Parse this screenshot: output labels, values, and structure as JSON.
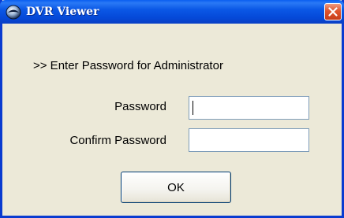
{
  "window": {
    "title": "DVR Viewer",
    "icon": "dvr-app-icon",
    "close_icon": "close-icon"
  },
  "dialog": {
    "prompt": ">> Enter Password for Administrator",
    "password_label": "Password",
    "password_value": "",
    "confirm_label": "Confirm Password",
    "confirm_value": "",
    "ok_label": "OK"
  },
  "colors": {
    "titlebar": "#0a5ef0",
    "window_border": "#0a3bd0",
    "dialog_background": "#ece9d8",
    "close_button": "#e0542c"
  }
}
